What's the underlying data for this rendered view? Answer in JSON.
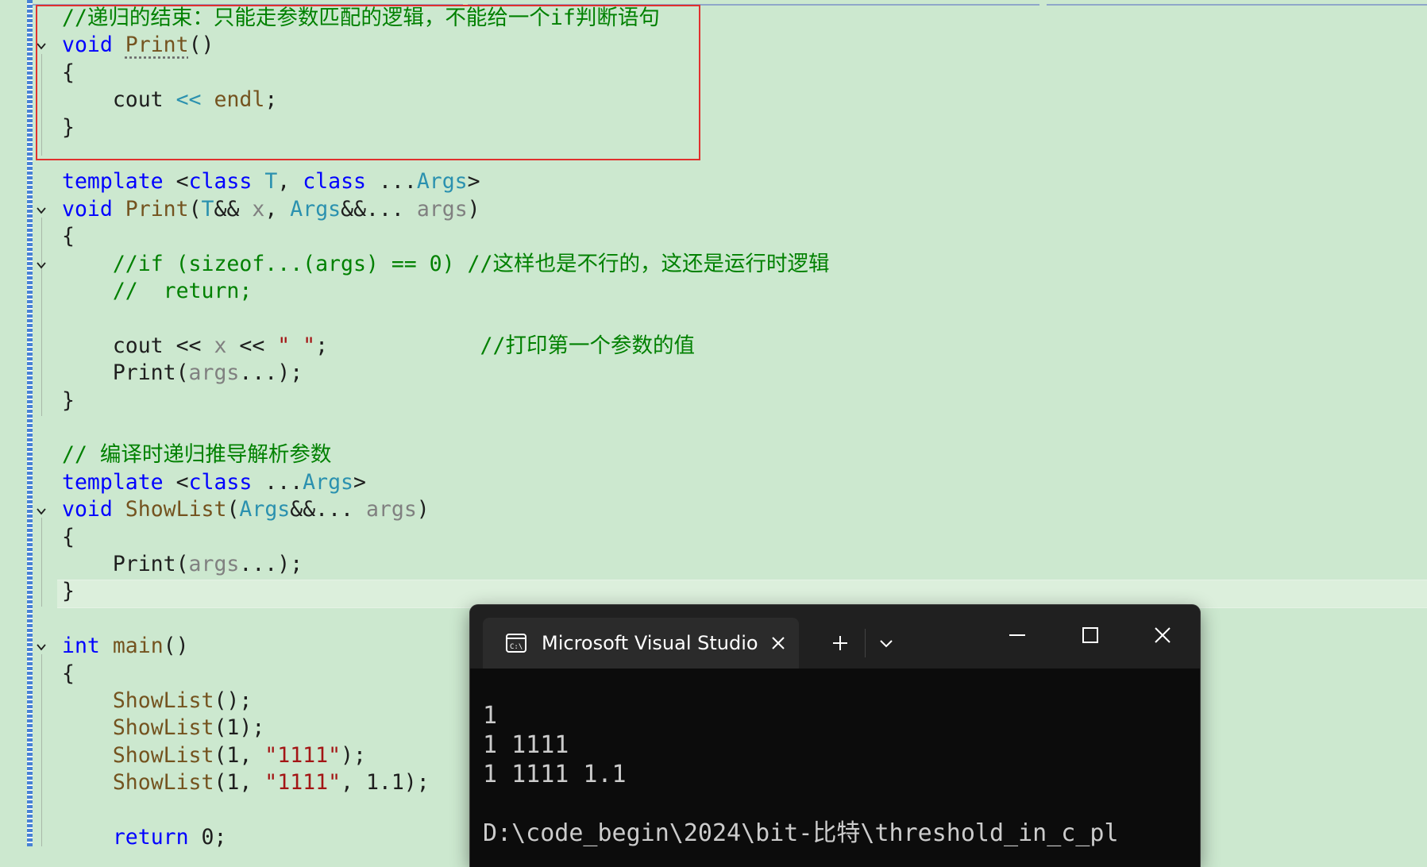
{
  "editor": {
    "lines": [
      {
        "id": "l1",
        "tokens": [
          {
            "t": "//递归的结束：只能走参数匹配的逻辑，不能给一个if判断语句",
            "c": "cm"
          }
        ]
      },
      {
        "id": "l2",
        "tokens": [
          {
            "t": "void",
            "c": "kw"
          },
          {
            "t": " "
          },
          {
            "t": "Print",
            "c": "fn",
            "sq": true
          },
          {
            "t": "()"
          }
        ]
      },
      {
        "id": "l3",
        "tokens": [
          {
            "t": "{"
          }
        ]
      },
      {
        "id": "l4",
        "tokens": [
          {
            "t": "    cout "
          },
          {
            "t": "<<",
            "c": "tp"
          },
          {
            "t": " "
          },
          {
            "t": "endl",
            "c": "fn"
          },
          {
            "t": ";"
          }
        ]
      },
      {
        "id": "l5",
        "tokens": [
          {
            "t": "}"
          }
        ]
      },
      {
        "id": "l6",
        "tokens": []
      },
      {
        "id": "l7",
        "tokens": [
          {
            "t": "template",
            "c": "kw"
          },
          {
            "t": " <"
          },
          {
            "t": "class",
            "c": "kw"
          },
          {
            "t": " "
          },
          {
            "t": "T",
            "c": "tp"
          },
          {
            "t": ", "
          },
          {
            "t": "class",
            "c": "kw"
          },
          {
            "t": " ..."
          },
          {
            "t": "Args",
            "c": "tp"
          },
          {
            "t": ">"
          }
        ]
      },
      {
        "id": "l8",
        "tokens": [
          {
            "t": "void",
            "c": "kw"
          },
          {
            "t": " "
          },
          {
            "t": "Print",
            "c": "fn"
          },
          {
            "t": "("
          },
          {
            "t": "T",
            "c": "tp"
          },
          {
            "t": "&& "
          },
          {
            "t": "x",
            "c": "pm"
          },
          {
            "t": ", "
          },
          {
            "t": "Args",
            "c": "tp"
          },
          {
            "t": "&&... "
          },
          {
            "t": "args",
            "c": "pm"
          },
          {
            "t": ")"
          }
        ]
      },
      {
        "id": "l9",
        "tokens": [
          {
            "t": "{"
          }
        ]
      },
      {
        "id": "l10",
        "tokens": [
          {
            "t": "    "
          },
          {
            "t": "//if (sizeof...(args) == 0) //这样也是不行的，这还是运行时逻辑",
            "c": "cm"
          }
        ]
      },
      {
        "id": "l11",
        "tokens": [
          {
            "t": "    "
          },
          {
            "t": "//  return;",
            "c": "cm"
          }
        ]
      },
      {
        "id": "l12",
        "tokens": []
      },
      {
        "id": "l13",
        "tokens": [
          {
            "t": "    cout << "
          },
          {
            "t": "x",
            "c": "pm"
          },
          {
            "t": " << "
          },
          {
            "t": "\" \"",
            "c": "st"
          },
          {
            "t": ";            "
          },
          {
            "t": "//打印第一个参数的值",
            "c": "cm"
          }
        ]
      },
      {
        "id": "l14",
        "tokens": [
          {
            "t": "    Print("
          },
          {
            "t": "args",
            "c": "pm"
          },
          {
            "t": "...);"
          }
        ]
      },
      {
        "id": "l15",
        "tokens": [
          {
            "t": "}"
          }
        ]
      },
      {
        "id": "l16",
        "tokens": []
      },
      {
        "id": "l17",
        "tokens": [
          {
            "t": "// 编译时递归推导解析参数",
            "c": "cm"
          }
        ]
      },
      {
        "id": "l18",
        "tokens": [
          {
            "t": "template",
            "c": "kw"
          },
          {
            "t": " <"
          },
          {
            "t": "class",
            "c": "kw"
          },
          {
            "t": " ..."
          },
          {
            "t": "Args",
            "c": "tp"
          },
          {
            "t": ">"
          }
        ]
      },
      {
        "id": "l19",
        "tokens": [
          {
            "t": "void",
            "c": "kw"
          },
          {
            "t": " "
          },
          {
            "t": "ShowList",
            "c": "fn"
          },
          {
            "t": "("
          },
          {
            "t": "Args",
            "c": "tp"
          },
          {
            "t": "&&... "
          },
          {
            "t": "args",
            "c": "pm"
          },
          {
            "t": ")"
          }
        ]
      },
      {
        "id": "l20",
        "tokens": [
          {
            "t": "{"
          }
        ]
      },
      {
        "id": "l21",
        "tokens": [
          {
            "t": "    Print("
          },
          {
            "t": "args",
            "c": "pm"
          },
          {
            "t": "...);"
          }
        ]
      },
      {
        "id": "l22",
        "tokens": [
          {
            "t": "}"
          }
        ]
      },
      {
        "id": "l23",
        "tokens": []
      },
      {
        "id": "l24",
        "tokens": [
          {
            "t": "int",
            "c": "kw"
          },
          {
            "t": " "
          },
          {
            "t": "main",
            "c": "fn"
          },
          {
            "t": "()"
          }
        ]
      },
      {
        "id": "l25",
        "tokens": [
          {
            "t": "{"
          }
        ]
      },
      {
        "id": "l26",
        "tokens": [
          {
            "t": "    "
          },
          {
            "t": "ShowList",
            "c": "fn"
          },
          {
            "t": "();"
          }
        ]
      },
      {
        "id": "l27",
        "tokens": [
          {
            "t": "    "
          },
          {
            "t": "ShowList",
            "c": "fn"
          },
          {
            "t": "(1);"
          }
        ]
      },
      {
        "id": "l28",
        "tokens": [
          {
            "t": "    "
          },
          {
            "t": "ShowList",
            "c": "fn"
          },
          {
            "t": "(1, "
          },
          {
            "t": "\"1111\"",
            "c": "st"
          },
          {
            "t": ");"
          }
        ]
      },
      {
        "id": "l29",
        "tokens": [
          {
            "t": "    "
          },
          {
            "t": "ShowList",
            "c": "fn"
          },
          {
            "t": "(1, "
          },
          {
            "t": "\"1111\"",
            "c": "st"
          },
          {
            "t": ", 1.1);"
          }
        ]
      },
      {
        "id": "l30",
        "tokens": []
      },
      {
        "id": "l31",
        "tokens": [
          {
            "t": "    "
          },
          {
            "t": "return",
            "c": "kw"
          },
          {
            "t": " 0;"
          }
        ]
      }
    ]
  },
  "terminal": {
    "tab_title": "Microsoft Visual Studio",
    "new_tab_symbol": "+",
    "output": [
      "",
      "1",
      "1 1111",
      "1 1111 1.1",
      "",
      "D:\\code_begin\\2024\\bit-比特\\threshold_in_c_pl"
    ]
  }
}
